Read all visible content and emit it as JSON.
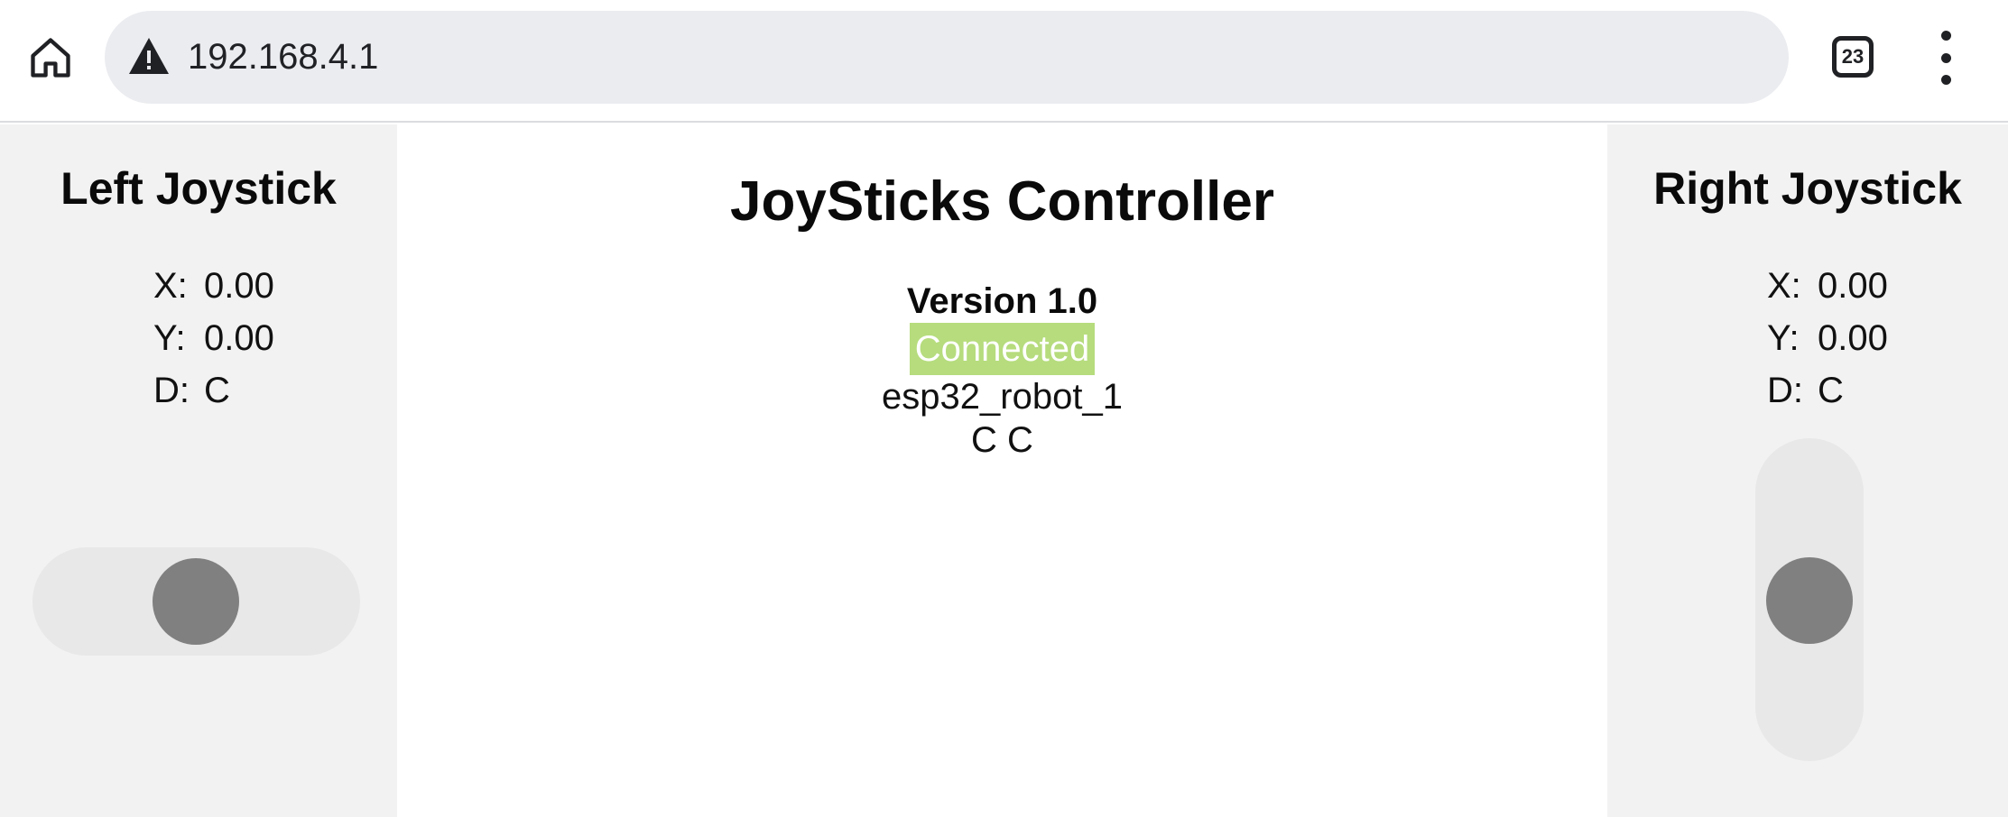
{
  "browser": {
    "url": "192.168.4.1",
    "tab_count": "23",
    "icons": {
      "home": "home-icon",
      "warning": "warning-icon",
      "tabs": "tab-switcher-icon",
      "menu": "more-vert-icon"
    }
  },
  "left_joystick": {
    "title": "Left Joystick",
    "x_label": "X:",
    "x_value": "0.00",
    "y_label": "Y:",
    "y_value": "0.00",
    "d_label": "D:",
    "d_value": "C",
    "orientation": "horizontal"
  },
  "right_joystick": {
    "title": "Right Joystick",
    "x_label": "X:",
    "x_value": "0.00",
    "y_label": "Y:",
    "y_value": "0.00",
    "d_label": "D:",
    "d_value": "C",
    "orientation": "vertical"
  },
  "center": {
    "title": "JoySticks Controller",
    "version": "Version 1.0",
    "status": "Connected",
    "device_name": "esp32_robot_1",
    "directions": "C C"
  },
  "colors": {
    "status_badge": "#b6dc7d",
    "side_panel": "#f2f2f2",
    "track": "#e8e8e8",
    "knob": "#808080"
  }
}
